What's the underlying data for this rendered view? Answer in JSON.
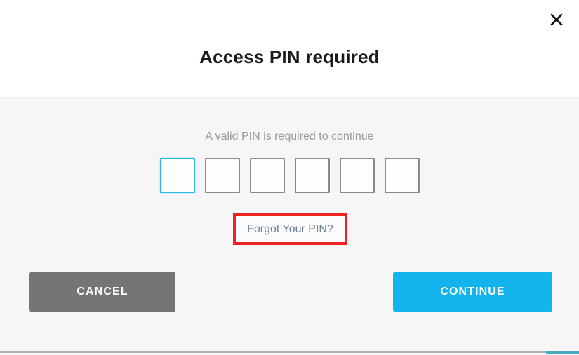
{
  "dialog": {
    "title": "Access PIN required",
    "close_icon": "close-icon",
    "instruction": "A valid PIN is required to continue",
    "pin": {
      "length": 6,
      "focused_index": 0,
      "values": [
        "",
        "",
        "",
        "",
        "",
        ""
      ],
      "focus_border_color": "#2cb8e8",
      "border_color": "#8b8b8b"
    },
    "forgot_link": {
      "label": "Forgot Your PIN?",
      "color": "#6d8296",
      "highlight_color": "#ef2222"
    },
    "buttons": {
      "cancel": {
        "label": "CANCEL",
        "bg_color": "#757575",
        "text_color": "#ffffff"
      },
      "continue": {
        "label": "CONTINUE",
        "bg_color": "#13b4ec",
        "text_color": "#ffffff"
      }
    },
    "colors": {
      "header_bg": "#ffffff",
      "body_bg": "#f6f6f6",
      "title_color": "#1a1a1a",
      "instruction_color": "#9a9a9a",
      "accent_bar": "#4ba9c4"
    }
  }
}
